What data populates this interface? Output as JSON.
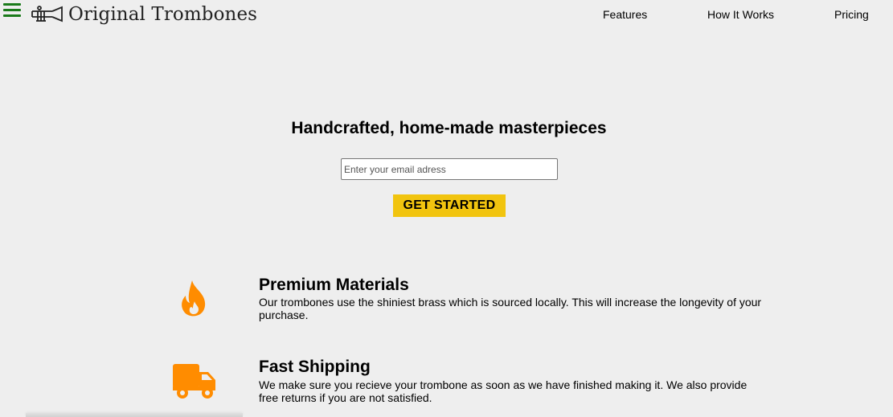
{
  "header": {
    "logo_text": "Original Trombones",
    "nav": {
      "features": "Features",
      "how_it_works": "How It Works",
      "pricing": "Pricing"
    }
  },
  "hero": {
    "title": "Handcrafted, home-made masterpieces",
    "email_placeholder": "Enter your email adress",
    "cta_label": "GET STARTED"
  },
  "features": [
    {
      "icon": "fire-icon",
      "title": "Premium Materials",
      "text": "Our trombones use the shiniest brass which is sourced locally. This will increase the longevity of your purchase."
    },
    {
      "icon": "truck-icon",
      "title": "Fast Shipping",
      "text": "We make sure you recieve your trombone as soon as we have finished making it. We also provide free returns if you are not satisfied."
    }
  ],
  "colors": {
    "background": "#eeeeee",
    "accent_yellow": "#f1c40f",
    "icon_orange": "#ff8c00",
    "menu_green": "#1a7a1a"
  }
}
